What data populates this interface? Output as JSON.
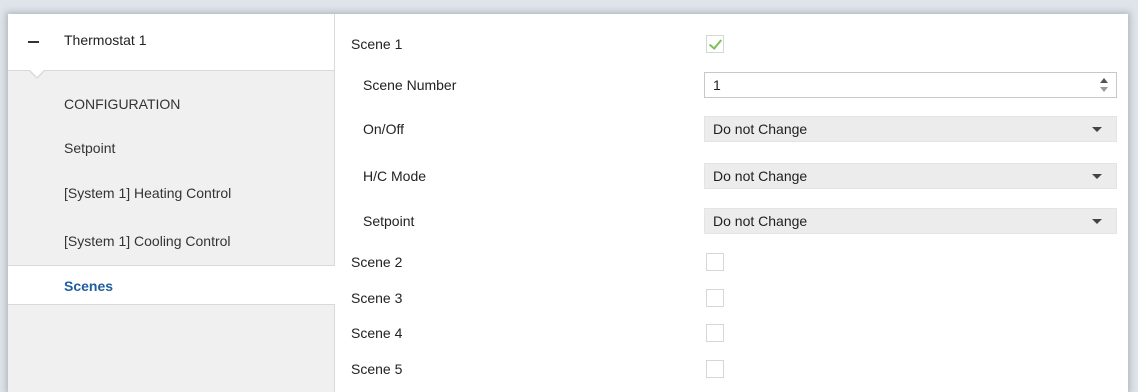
{
  "sidebar": {
    "header_title": "Thermostat 1",
    "items": [
      {
        "label": "CONFIGURATION"
      },
      {
        "label": "Setpoint"
      },
      {
        "label": "[System 1] Heating Control"
      },
      {
        "label": "[System 1] Cooling Control"
      },
      {
        "label": "Scenes",
        "active": true
      }
    ]
  },
  "main": {
    "scene1": {
      "label": "Scene 1",
      "checked": true
    },
    "scene_number": {
      "label": "Scene Number",
      "value": "1"
    },
    "on_off": {
      "label": "On/Off",
      "value": "Do not Change"
    },
    "hc_mode": {
      "label": "H/C Mode",
      "value": "Do not Change"
    },
    "setpoint": {
      "label": "Setpoint",
      "value": "Do not Change"
    },
    "scene2": {
      "label": "Scene 2",
      "checked": false
    },
    "scene3": {
      "label": "Scene 3",
      "checked": false
    },
    "scene4": {
      "label": "Scene 4",
      "checked": false
    },
    "scene5": {
      "label": "Scene 5",
      "checked": false
    }
  },
  "colors": {
    "active_nav_text": "#1f5f9e",
    "check_mark": "#7cc05a",
    "select_background": "#ececec"
  },
  "icons": [
    "collapse-icon",
    "checkmark-icon",
    "spinner-up-icon",
    "spinner-down-icon",
    "dropdown-arrow-icon"
  ]
}
